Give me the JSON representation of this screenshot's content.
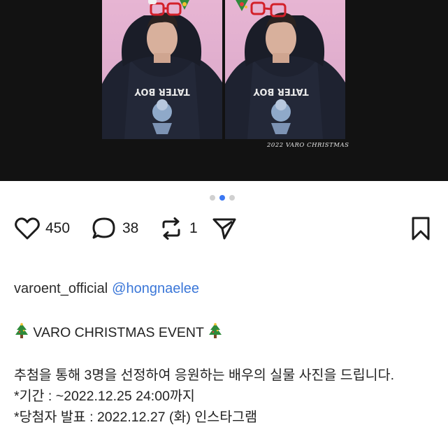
{
  "media": {
    "caption": "2022 VARO CHRISTMAS",
    "shirt_text": "TATER BOY",
    "carousel": {
      "count": 3,
      "active_index": 1
    }
  },
  "actions": {
    "like_count": "450",
    "comment_count": "38",
    "repost_count": "1"
  },
  "post": {
    "author": "varoent_official",
    "mention": "@hongnaelee",
    "title": "VARO CHRISTMAS EVENT",
    "line1": "추첨을 통해 3명을 선정하여 응원하는 배우의 실물 사진을 드립니다.",
    "line2": "*기간 : ~2022.12.25 24:00까지",
    "line3": "*당첨자 발표 : 2022.12.27 (화) 인스타그램"
  },
  "colors": {
    "link": "#3b77d8",
    "carousel_active": "#3b77f2",
    "photo_bg": "#e0aecd"
  }
}
